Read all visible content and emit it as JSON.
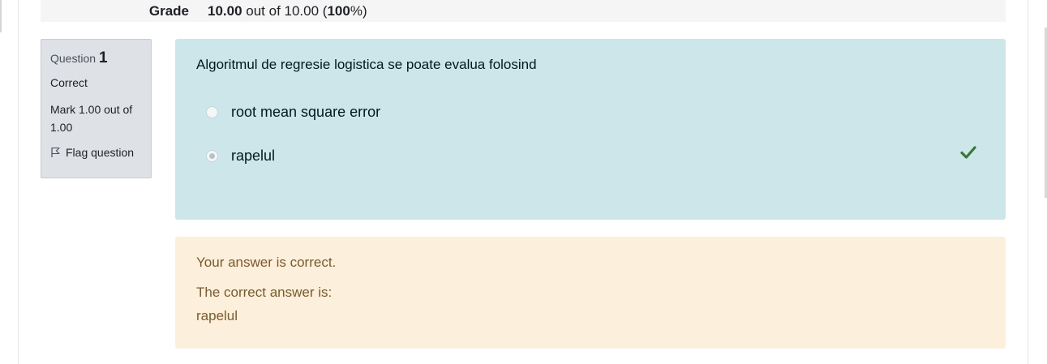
{
  "summary": {
    "grade_label": "Grade",
    "grade_score": "10.00",
    "grade_out_of_text": " out of 10.00 (",
    "grade_percent": "100",
    "grade_suffix": "%)"
  },
  "question_info": {
    "question_label": "Question",
    "question_number": "1",
    "state": "Correct",
    "mark_text": "Mark 1.00 out of 1.00",
    "flag_label": "Flag question"
  },
  "formulation": {
    "question_text": "Algoritmul de regresie logistica se poate evalua folosind",
    "answers": [
      {
        "label": "root mean square error",
        "selected": false
      },
      {
        "label": "rapelul",
        "selected": true,
        "correct": true
      }
    ]
  },
  "feedback": {
    "result": "Your answer is correct.",
    "correct_answer_label": "The correct answer is:",
    "correct_answer": "rapelul"
  },
  "colors": {
    "formulation_bg": "#cce6ea",
    "feedback_bg": "#fcefdc",
    "correct_green": "#357a32"
  }
}
